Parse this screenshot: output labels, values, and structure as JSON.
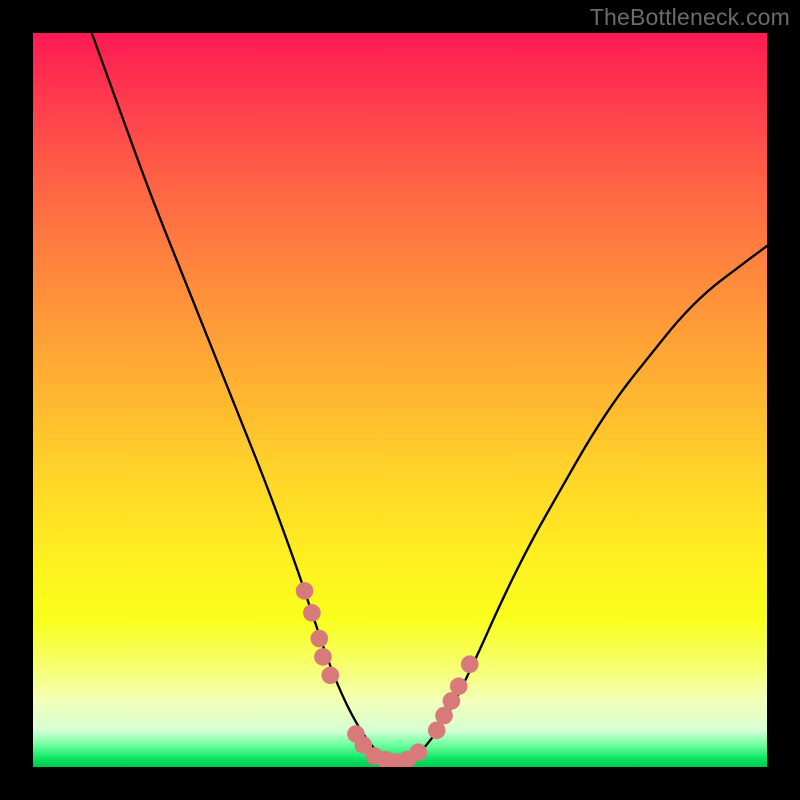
{
  "watermark": "TheBottleneck.com",
  "chart_data": {
    "type": "line",
    "title": "",
    "xlabel": "",
    "ylabel": "",
    "xlim": [
      0,
      100
    ],
    "ylim": [
      0,
      100
    ],
    "background": {
      "type": "vertical-gradient",
      "stops": [
        {
          "pos": 0,
          "color": "#ff1a54"
        },
        {
          "pos": 22,
          "color": "#ff6844"
        },
        {
          "pos": 48,
          "color": "#ffb232"
        },
        {
          "pos": 72,
          "color": "#fff020"
        },
        {
          "pos": 91,
          "color": "#f3ffb8"
        },
        {
          "pos": 100,
          "color": "#03c84f"
        }
      ]
    },
    "series": [
      {
        "name": "bottleneck-curve",
        "color": "#000000",
        "x": [
          8,
          12,
          16,
          20,
          24,
          28,
          32,
          36,
          38,
          40,
          42,
          44,
          46,
          48,
          50,
          52,
          56,
          60,
          64,
          68,
          72,
          76,
          80,
          84,
          88,
          92,
          96,
          100
        ],
        "y": [
          100,
          89,
          78,
          68,
          58,
          48,
          38,
          27,
          21,
          15,
          10,
          6,
          3,
          1,
          0.5,
          1,
          6,
          14,
          23,
          31,
          38,
          45,
          51,
          56,
          61,
          65,
          68,
          71
        ]
      }
    ],
    "markers": {
      "color": "#d87a7a",
      "radius": 1.2,
      "points": [
        {
          "x": 37,
          "y": 24
        },
        {
          "x": 38,
          "y": 21
        },
        {
          "x": 39,
          "y": 17.5
        },
        {
          "x": 39.5,
          "y": 15
        },
        {
          "x": 40.5,
          "y": 12.5
        },
        {
          "x": 44,
          "y": 4.5
        },
        {
          "x": 45,
          "y": 3
        },
        {
          "x": 46.5,
          "y": 1.5
        },
        {
          "x": 48,
          "y": 1
        },
        {
          "x": 49.5,
          "y": 0.7
        },
        {
          "x": 51,
          "y": 1
        },
        {
          "x": 52.5,
          "y": 2
        },
        {
          "x": 55,
          "y": 5
        },
        {
          "x": 56,
          "y": 7
        },
        {
          "x": 57,
          "y": 9
        },
        {
          "x": 58,
          "y": 11
        },
        {
          "x": 59.5,
          "y": 14
        }
      ]
    }
  }
}
